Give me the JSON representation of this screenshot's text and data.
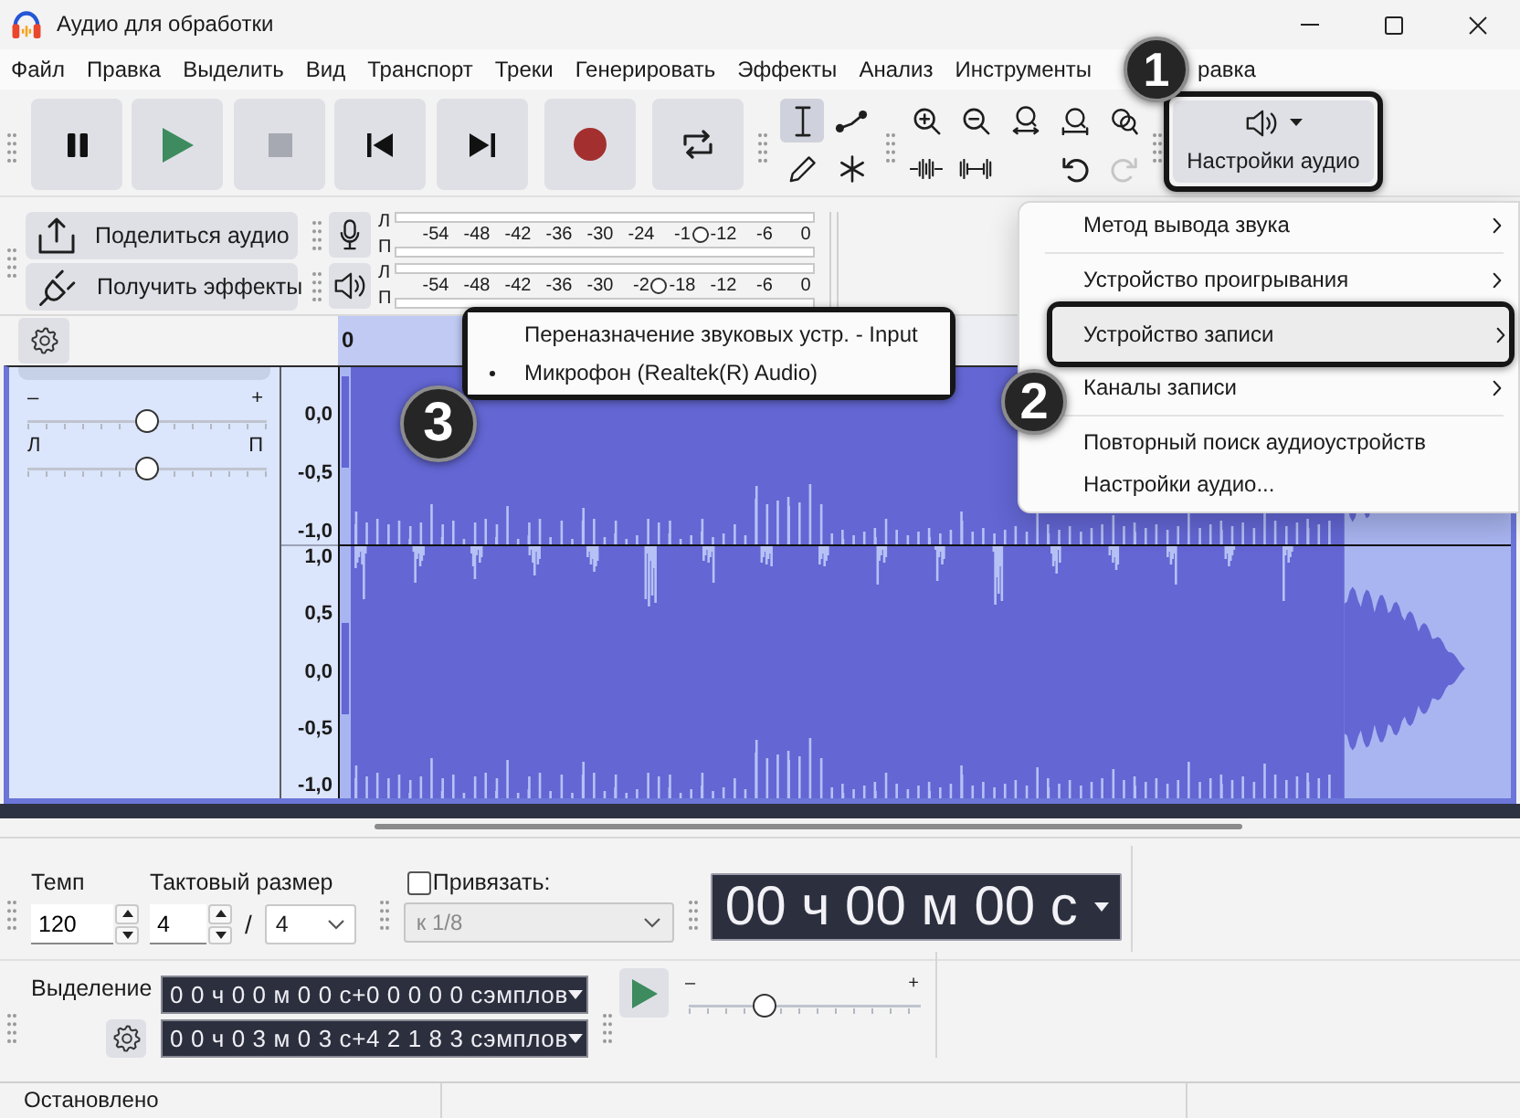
{
  "window": {
    "title": "Аудио для обработки"
  },
  "menu_bar": {
    "items": [
      "Файл",
      "Правка",
      "Выделить",
      "Вид",
      "Транспорт",
      "Треки",
      "Генерировать",
      "Эффекты",
      "Анализ",
      "Инструменты",
      "равка"
    ]
  },
  "tools": [
    {
      "selected": true
    },
    {
      "selected": false
    },
    {
      "selected": false
    },
    {
      "selected": false
    }
  ],
  "edit_buttons": [
    {
      "disabled": false
    },
    {
      "disabled": true
    }
  ],
  "audio_setup": {
    "label": "Настройки аудио",
    "callout": "1"
  },
  "share_buttons": [
    {
      "label": "Поделиться аудио"
    },
    {
      "label": "Получить эффекты"
    }
  ],
  "meters": [
    {
      "channels": [
        "Л",
        "П"
      ],
      "scale": [
        "-54",
        "-48",
        "-42",
        "-36",
        "-30",
        "-24",
        "-1",
        "-12",
        "-6",
        "0"
      ],
      "level": 0.744
    },
    {
      "channels": [
        "Л",
        "П"
      ],
      "scale": [
        "-54",
        "-48",
        "-42",
        "-36",
        "-30",
        "-2",
        "-18",
        "-12",
        "-6",
        "0"
      ],
      "level": 0.644
    }
  ],
  "ruler": {
    "labels": [
      "0"
    ]
  },
  "track": {
    "gain": {
      "min_label": "–",
      "max_label": "+",
      "level": 0.5
    },
    "pan": {
      "min_label": "Л",
      "max_label": "П",
      "level": 0.5
    },
    "scales": [
      [
        "0,0",
        "-0,5",
        "-1,0"
      ],
      [
        "1,0",
        "0,5",
        "0,0",
        "-0,5",
        "-1,0"
      ]
    ]
  },
  "audio_setup_menu": {
    "items": [
      {
        "kind": "item",
        "label": "Метод вывода звука",
        "submenu": true,
        "selected": false
      },
      {
        "kind": "separator"
      },
      {
        "kind": "item",
        "label": "Устройство проигрывания",
        "submenu": true,
        "selected": false
      },
      {
        "kind": "item",
        "label": "Устройство записи",
        "submenu": true,
        "selected": true,
        "callout": "2"
      },
      {
        "kind": "item",
        "label": "Каналы записи",
        "submenu": true,
        "selected": false
      },
      {
        "kind": "separator"
      },
      {
        "kind": "item",
        "label": "Повторный поиск аудиоустройств",
        "submenu": false,
        "selected": false
      },
      {
        "kind": "item",
        "label": "Настройки аудио...",
        "submenu": false,
        "selected": false
      }
    ]
  },
  "recording_device_menu": {
    "callout": "3",
    "items": [
      {
        "label": "Переназначение звуковых устр. - Input",
        "checked": false
      },
      {
        "label": "Микрофон (Realtek(R) Audio)",
        "checked": true
      }
    ]
  },
  "time_signature": {
    "tempo_label": "Темп",
    "tempo": "120",
    "meter_label": "Тактовый размер",
    "upper": "4",
    "separator": "/",
    "lower": "4"
  },
  "snap": {
    "label": "Привязать:",
    "checked": false,
    "value": "к 1/8",
    "disabled": true
  },
  "time_display": {
    "value": "00 ч 00 м 00 с"
  },
  "selection": {
    "label": "Выделение",
    "start": "0 0 ч 0 0 м 0 0 с+0 0 0 0 0 сэмплов",
    "end": "0 0 ч 0 3 м 0 3 с+4 2 1 8 3 сэмплов"
  },
  "play_at_speed": {
    "min_label": "–",
    "max_label": "+",
    "level": 0.33
  },
  "status_bar": {
    "text": "Остановлено"
  }
}
